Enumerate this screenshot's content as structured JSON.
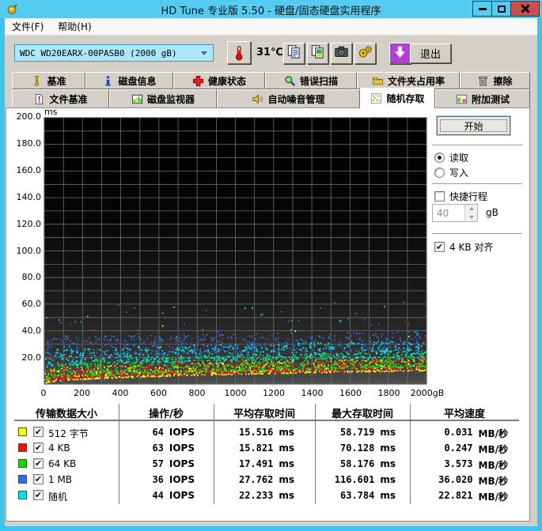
{
  "window": {
    "title": "HD Tune 专业版 5.50 - 硬盘/固态硬盘实用程序"
  },
  "menu": {
    "file": "文件(F)",
    "help": "帮助(H)"
  },
  "toolbar": {
    "drive_value": "WDC WD20EARX-00PASB0 (2000 gB)",
    "temperature": "31℃",
    "exit_label": "退出",
    "icon_buttons": [
      {
        "id": "copy-text-button",
        "icon": "copy-text-icon"
      },
      {
        "id": "copy-image-button",
        "icon": "copy-image-icon"
      },
      {
        "id": "screenshot-button",
        "icon": "camera-icon"
      },
      {
        "id": "options-button",
        "icon": "options-icon"
      },
      {
        "id": "update-button",
        "icon": "download-arrow-icon"
      }
    ]
  },
  "tabs": {
    "row1": [
      {
        "id": "benchmark",
        "icon": "exclamation-icon",
        "label": "基准",
        "active": false
      },
      {
        "id": "disk-info",
        "icon": "info-icon",
        "label": "磁盘信息",
        "active": false
      },
      {
        "id": "health",
        "icon": "health-cross-icon",
        "label": "健康状态",
        "active": false
      },
      {
        "id": "error-scan",
        "icon": "magnifier-icon",
        "label": "错误扫描",
        "active": false
      },
      {
        "id": "folder-usage",
        "icon": "folder-icon",
        "label": "文件夹占用率",
        "active": false
      },
      {
        "id": "erase",
        "icon": "trash-icon",
        "label": "擦除",
        "active": false
      }
    ],
    "row2": [
      {
        "id": "file-benchmark",
        "icon": "file-benchmark-icon",
        "label": "文件基准",
        "active": false
      },
      {
        "id": "disk-monitor",
        "icon": "disk-monitor-icon",
        "label": "磁盘监视器",
        "active": false
      },
      {
        "id": "noise-management",
        "icon": "speaker-icon",
        "label": "自动噪音管理",
        "active": false
      },
      {
        "id": "random-access",
        "icon": "random-access-icon",
        "label": "随机存取",
        "active": true
      },
      {
        "id": "extra-tests",
        "icon": "extra-tests-icon",
        "label": "附加测试",
        "active": false
      }
    ]
  },
  "controls": {
    "start": "开始",
    "read": "读取",
    "write": "写入",
    "read_selected": true,
    "write_selected": false,
    "short_stroke": "快捷行程",
    "short_stroke_checked": false,
    "stroke_value": "40",
    "stroke_unit": "gB",
    "align": "4 KB 对齐",
    "align_checked": true
  },
  "chart_data": {
    "type": "scatter",
    "ylabel_unit": "ms",
    "x_axis_suffix": "gB",
    "xlim": [
      0,
      2000
    ],
    "ylim": [
      0,
      200
    ],
    "grid_step_x_gb": 100,
    "grid_step_y_ms": 10,
    "x_tick_labels": [
      "0",
      "200",
      "400",
      "600",
      "800",
      "1000",
      "1200",
      "1400",
      "1600",
      "1800",
      "2000gB"
    ],
    "y_tick_labels": [
      "200.0",
      "180.0",
      "160.0",
      "140.0",
      "120.0",
      "100.0",
      "80.0",
      "60.0",
      "40.0",
      "20.0"
    ],
    "legend_position": "table-below-left",
    "series": [
      {
        "name": "512 字节",
        "color": "#ffff00",
        "checked": true,
        "iops": "64",
        "avg_ms": "15.516",
        "max_ms": "58.719",
        "speed": "0.031",
        "scatter": {
          "count": 750,
          "seed": 11,
          "y_start": 2.5,
          "y_end": 12,
          "spread": 8,
          "skew": 1.9,
          "outlier_max": 48,
          "outlier_rate": 0.012
        }
      },
      {
        "name": "4 KB",
        "color": "#e81414",
        "checked": true,
        "iops": "63",
        "avg_ms": "15.821",
        "max_ms": "70.128",
        "speed": "0.247",
        "scatter": {
          "count": 750,
          "seed": 22,
          "y_start": 3.5,
          "y_end": 13,
          "spread": 8,
          "skew": 1.9,
          "outlier_max": 55,
          "outlier_rate": 0.015
        }
      },
      {
        "name": "64 KB",
        "color": "#17d417",
        "checked": true,
        "iops": "57",
        "avg_ms": "17.491",
        "max_ms": "58.176",
        "speed": "3.573",
        "scatter": {
          "count": 750,
          "seed": 33,
          "y_start": 5,
          "y_end": 15,
          "spread": 10,
          "skew": 1.9,
          "outlier_max": 55,
          "outlier_rate": 0.02
        }
      },
      {
        "name": "1 MB",
        "color": "#2e6cdc",
        "checked": true,
        "iops": "36",
        "avg_ms": "27.762",
        "max_ms": "116.601",
        "speed": "36.020",
        "scatter": {
          "count": 520,
          "seed": 44,
          "y_start": 21,
          "y_end": 27,
          "spread": 13,
          "skew": 1.25,
          "outlier_max": 62,
          "outlier_rate": 0.05
        }
      },
      {
        "name": "随机",
        "color": "#00e4e4",
        "checked": true,
        "iops": "44",
        "avg_ms": "22.233",
        "max_ms": "63.784",
        "speed": "22.821",
        "scatter": {
          "count": 620,
          "seed": 55,
          "y_start": 14,
          "y_end": 22,
          "spread": 11,
          "skew": 1.4,
          "outlier_max": 60,
          "outlier_rate": 0.035
        }
      }
    ]
  },
  "results_table": {
    "headers": [
      "传输数据大小",
      "操作/秒",
      "平均存取时间",
      "最大存取时间",
      "平均速度"
    ],
    "units": {
      "ops": "IOPS",
      "time": "ms",
      "speed": "MB/秒"
    }
  }
}
